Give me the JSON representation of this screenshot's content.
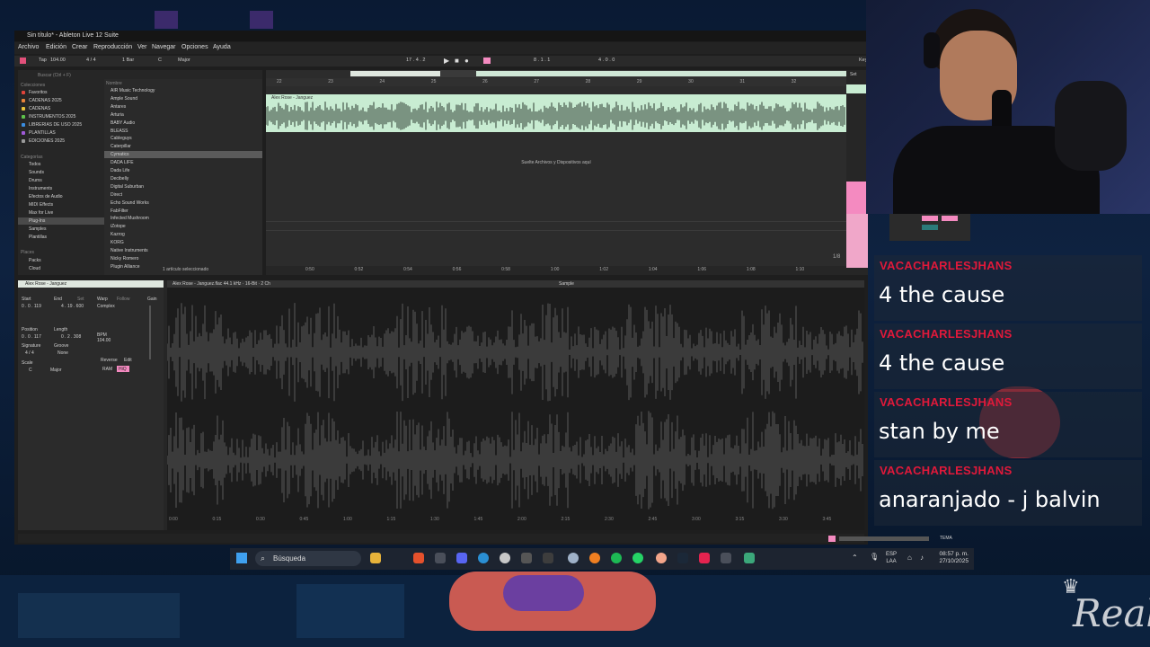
{
  "window": {
    "title": "Sin título* - Ableton Live 12 Suite"
  },
  "menu": [
    "Archivo",
    "Edición",
    "Crear",
    "Reproducción",
    "Ver",
    "Navegar",
    "Opciones",
    "Ayuda"
  ],
  "controlbar": {
    "tap": "Tap",
    "tempo": "104.00",
    "meter": "4 / 4",
    "quant": "1 Bar",
    "key": "C",
    "scale": "Major",
    "position": "17 . 4 . 2",
    "loop_start": "8 . 1 . 1",
    "loop_len": "4 . 0 . 0",
    "keys": "Key"
  },
  "browser": {
    "search_placeholder": "Buscar (Ctrl + F)",
    "collections_header": "Colecciones",
    "collections": [
      {
        "label": "Favoritos",
        "color": "#e0433a"
      },
      {
        "label": "CADENAS 2025",
        "color": "#e8833a"
      },
      {
        "label": "CADENAS",
        "color": "#e8c23a"
      },
      {
        "label": "INSTRUMENTOS 2025",
        "color": "#5ec24b"
      },
      {
        "label": "LIBRERIAS DE USO 2025",
        "color": "#3a8de0"
      },
      {
        "label": "PLANTILLAS",
        "color": "#a05ad8"
      },
      {
        "label": "EDICIONES 2025",
        "color": "#9a9a9a"
      }
    ],
    "categories_header": "Categorías",
    "categories": [
      "Todos",
      "Sounds",
      "Drums",
      "Instruments",
      "Efectos de Audio",
      "MIDI Effects",
      "Max for Live",
      "Plug-Ins",
      "Samples",
      "Plantillas"
    ],
    "places_header": "Places",
    "places": [
      "Packs",
      "Cloud"
    ],
    "name_header": "Nombre",
    "items": [
      "AIR Music Technology",
      "Ample Sound",
      "Antares",
      "Arturia",
      "BABY Audio",
      "BLEASS",
      "Cableguys",
      "Caterpillar",
      "Cymatics",
      "DADA LIFE",
      "Dada Life",
      "Decibelly",
      "Digital Suburban",
      "Direct",
      "Echo Sound Works",
      "FabFilter",
      "Infected Mushroom",
      "iZotope",
      "Kazrog",
      "KORG",
      "Native Instruments",
      "Nicky Romero",
      "Plugin Alliance"
    ],
    "selected_item": "Dada Life",
    "footer": "1 artículo seleccionado"
  },
  "arrangement": {
    "ruler": [
      "22",
      "23",
      "24",
      "25",
      "26",
      "27",
      "28",
      "29",
      "30",
      "31",
      "32"
    ],
    "clip_name": "Alex Rose - Janguez",
    "drop_hint": "Suelte Archivos y Dispositivos aquí",
    "time_ruler": [
      "0:50",
      "0:52",
      "0:54",
      "0:56",
      "0:58",
      "1:00",
      "1:02",
      "1:04",
      "1:06",
      "1:08",
      "1:10"
    ],
    "zoom": "1/8",
    "set_label": "Set"
  },
  "clip": {
    "header": "Alex Rose - Janguez",
    "start_label": "Start",
    "end_label": "End",
    "set_label": "Set",
    "start": "0 . 0 . 119",
    "end": "4 . 19 . 600",
    "position_label": "Position",
    "length_label": "Length",
    "position": "0 . 0 . 117",
    "length": "0 . 2 . 308",
    "signature_label": "Signature",
    "groove_label": "Groove",
    "signature": "4 / 4",
    "groove": "None",
    "scale_label": "Scale",
    "key": "C",
    "scale": "Major",
    "warp": "Warp",
    "follow": "Follow",
    "warp_mode": "Complex",
    "bpm_label": "BPM",
    "bpm": "104.00",
    "reverse": "Reverse",
    "edit": "Edit",
    "ram": "RAM",
    "hiq": "HiQ",
    "gain": "Gain",
    "file_info": "Alex Rose - Janguez.flac  44.1 kHz · 16-Bit · 2 Ch",
    "sample_tab": "Sample"
  },
  "sample_ruler": [
    "0:00",
    "0:15",
    "0:30",
    "0:45",
    "1:00",
    "1:15",
    "1:30",
    "1:45",
    "2:00",
    "2:15",
    "2:30",
    "2:45",
    "3:00",
    "3:15",
    "3:30",
    "3:45"
  ],
  "status": {
    "track": "TEMA"
  },
  "taskbar": {
    "search": "Búsqueda",
    "lang_top": "ESP",
    "lang_bottom": "LAA",
    "time": "08:57 p. m.",
    "date": "27/10/2025"
  },
  "chat": [
    {
      "user": "VACACHARLESJHANS",
      "message": "4 the cause"
    },
    {
      "user": "VACACHARLESJHANS",
      "message": "4 the cause"
    },
    {
      "user": "VACACHARLESJHANS",
      "message": "stan by me"
    },
    {
      "user": "VACACHARLESJHANS",
      "message": "anaranjado - j balvin"
    }
  ],
  "colors": {
    "accent_clip": "#c8ecd2",
    "chat_name": "#e0193a",
    "pink": "#f48ac0",
    "taskbar": "#1d2430"
  },
  "watermark": "Real"
}
